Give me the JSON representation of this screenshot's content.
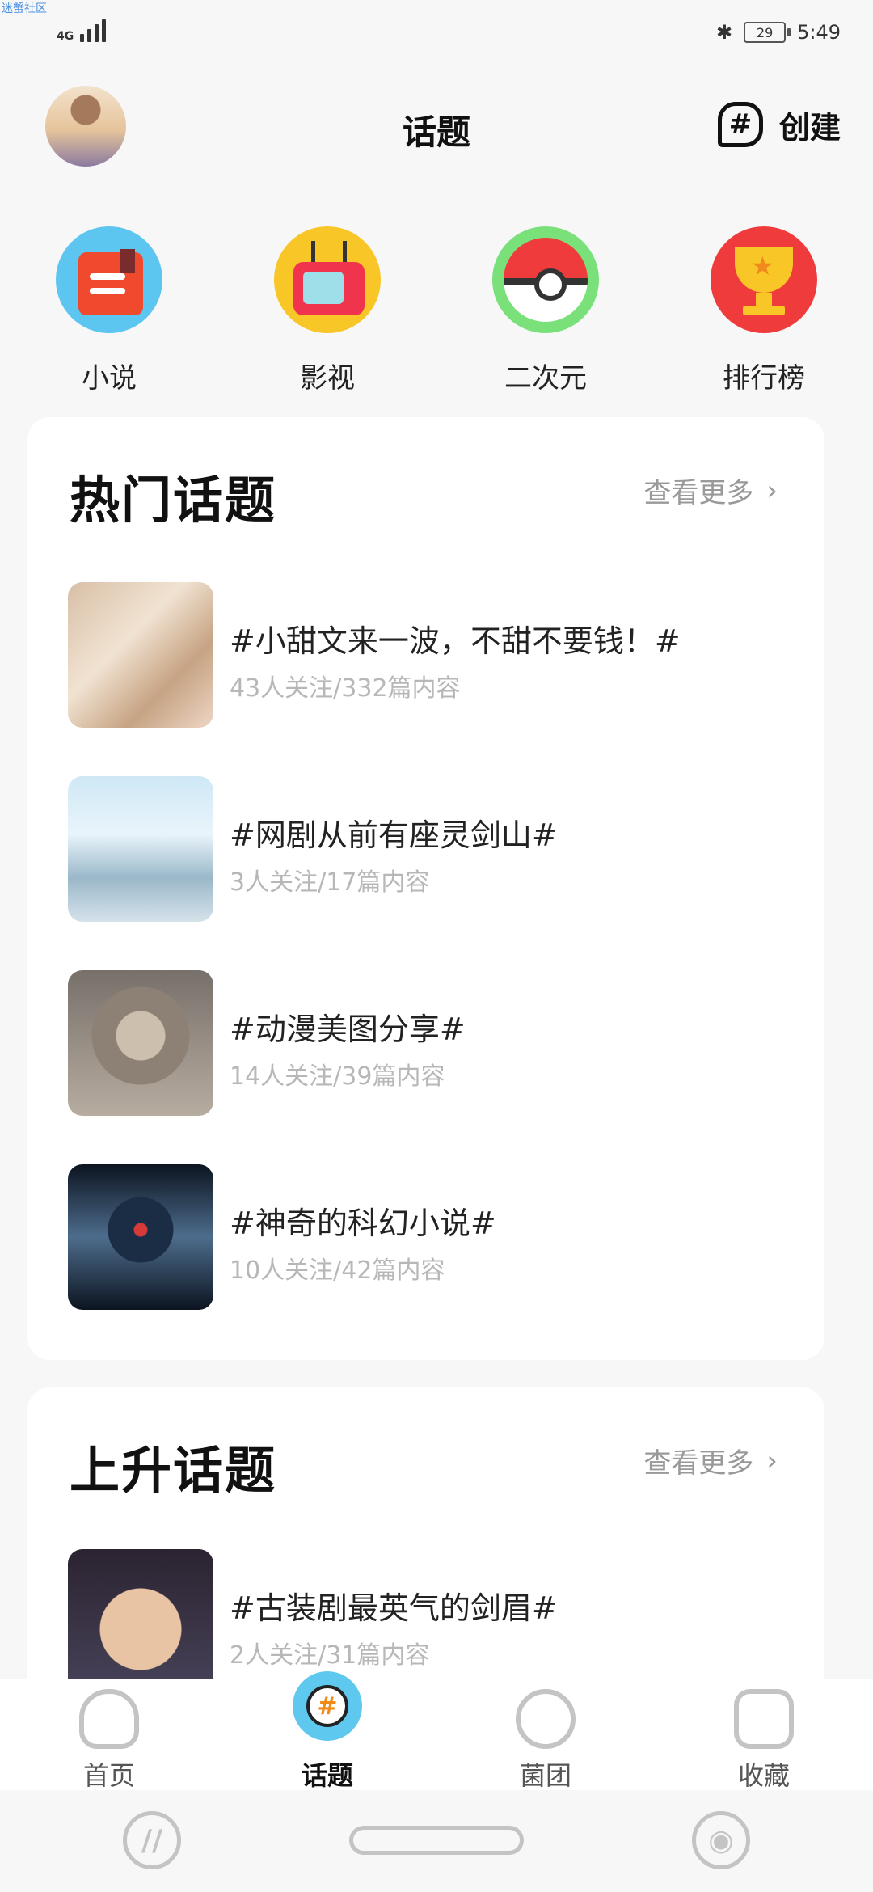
{
  "watermark": "迷蟹社区",
  "status_bar": {
    "network": "4G",
    "battery": "29",
    "time": "5:49",
    "bluetooth_icon": "bluetooth-icon"
  },
  "header": {
    "title": "话题",
    "create_label": "创建",
    "create_icon": "#"
  },
  "categories": [
    {
      "label": "小说",
      "icon": "book-icon"
    },
    {
      "label": "影视",
      "icon": "tv-icon"
    },
    {
      "label": "二次元",
      "icon": "pokeball-icon"
    },
    {
      "label": "排行榜",
      "icon": "trophy-icon"
    }
  ],
  "hot": {
    "title": "热门话题",
    "more": "查看更多",
    "more_icon": "›",
    "topics": [
      {
        "name": "#小甜文来一波，不甜不要钱！#",
        "meta": "43人关注/332篇内容"
      },
      {
        "name": "#网剧从前有座灵剑山#",
        "meta": "3人关注/17篇内容"
      },
      {
        "name": "#动漫美图分享#",
        "meta": "14人关注/39篇内容"
      },
      {
        "name": "#神奇的科幻小说#",
        "meta": "10人关注/42篇内容"
      }
    ]
  },
  "rising": {
    "title": "上升话题",
    "more": "查看更多",
    "more_icon": "›",
    "topics": [
      {
        "name": "#古装剧最英气的剑眉#",
        "meta": "2人关注/31篇内容"
      }
    ]
  },
  "bottom_nav": {
    "items": [
      {
        "label": "首页"
      },
      {
        "label": "话题",
        "active": true,
        "icon_text": "#"
      },
      {
        "label": "菌团"
      },
      {
        "label": "收藏"
      }
    ]
  },
  "system_nav": {
    "left_icon": "//",
    "right_icon": "◉"
  }
}
